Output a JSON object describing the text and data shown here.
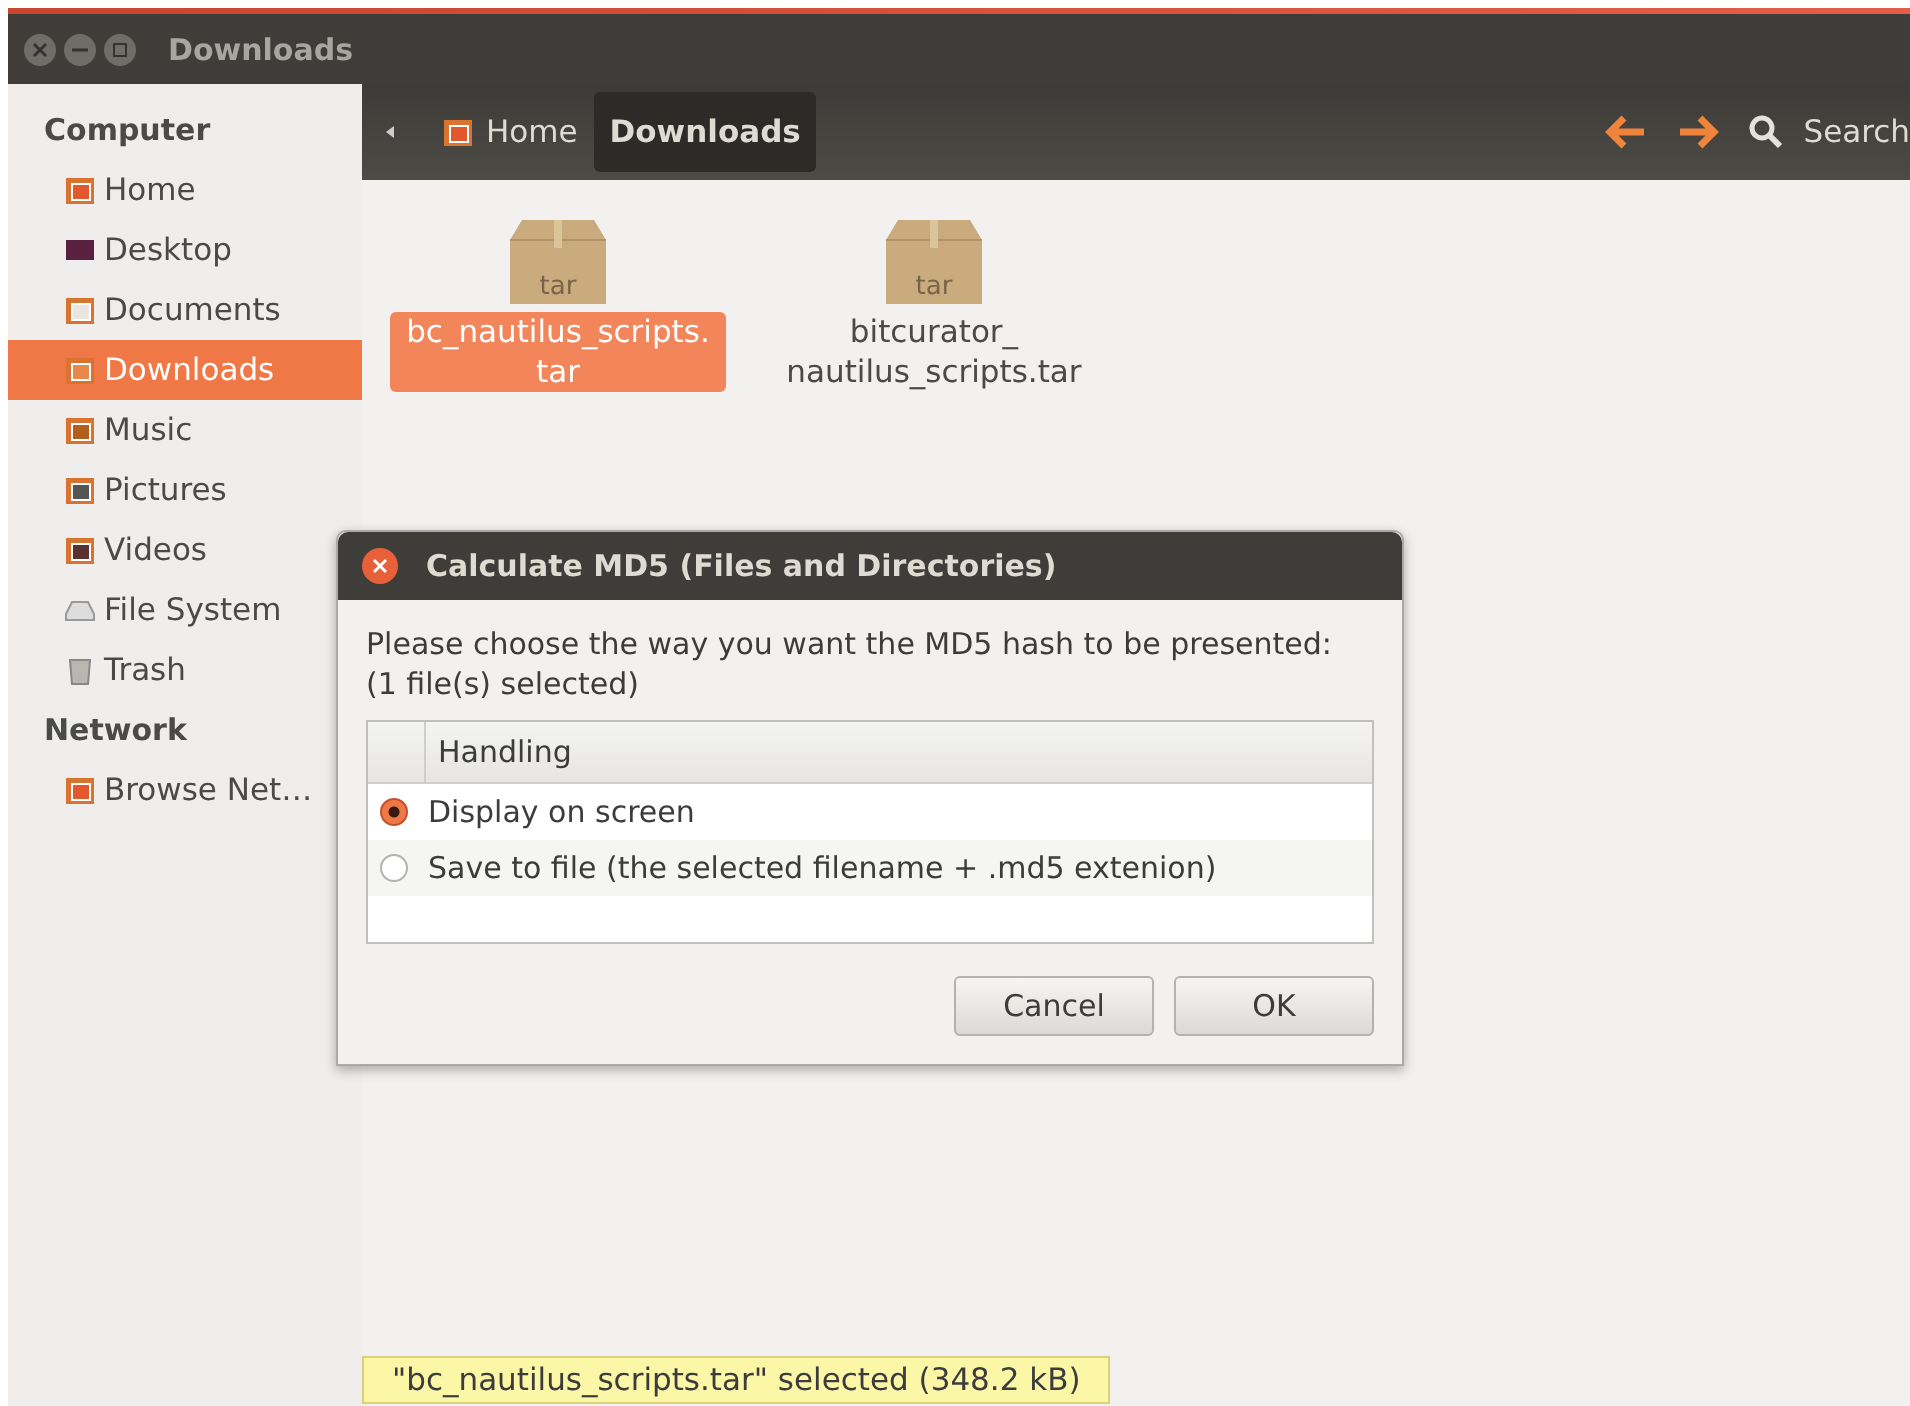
{
  "window": {
    "title": "Downloads"
  },
  "sidebar": {
    "sections": [
      {
        "heading": "Computer",
        "items": [
          {
            "label": "Home",
            "kind": "home",
            "selected": false
          },
          {
            "label": "Desktop",
            "kind": "desktop",
            "selected": false
          },
          {
            "label": "Documents",
            "kind": "documents",
            "selected": false
          },
          {
            "label": "Downloads",
            "kind": "downloads",
            "selected": true
          },
          {
            "label": "Music",
            "kind": "music",
            "selected": false
          },
          {
            "label": "Pictures",
            "kind": "pictures",
            "selected": false
          },
          {
            "label": "Videos",
            "kind": "videos",
            "selected": false
          },
          {
            "label": "File System",
            "kind": "drive",
            "selected": false
          },
          {
            "label": "Trash",
            "kind": "trash",
            "selected": false
          }
        ]
      },
      {
        "heading": "Network",
        "items": [
          {
            "label": "Browse Net…",
            "kind": "network",
            "selected": false
          }
        ]
      }
    ]
  },
  "toolbar": {
    "path": [
      {
        "label": "Home",
        "kind": "home",
        "selected": false
      },
      {
        "label": "Downloads",
        "kind": "plain",
        "selected": true
      }
    ],
    "search": "Search"
  },
  "files": [
    {
      "name": "bc_nautilus_scripts.\ntar",
      "type": "tar",
      "selected": true
    },
    {
      "name": "bitcurator_\nnautilus_scripts.tar",
      "type": "tar",
      "selected": false
    }
  ],
  "dialog": {
    "title": "Calculate MD5 (Files and Directories)",
    "message": [
      "Please choose the way you want the MD5 hash to be presented:",
      "(1 file(s) selected)"
    ],
    "column_2": "Handling",
    "options": [
      {
        "label": "Display on screen",
        "selected": true
      },
      {
        "label": "Save to file (the selected filename + .md5 extenion)",
        "selected": false
      }
    ],
    "buttons": [
      "Cancel",
      "OK"
    ]
  },
  "status_bar": "\"bc_nautilus_scripts.tar\" selected (348.2 kB)"
}
